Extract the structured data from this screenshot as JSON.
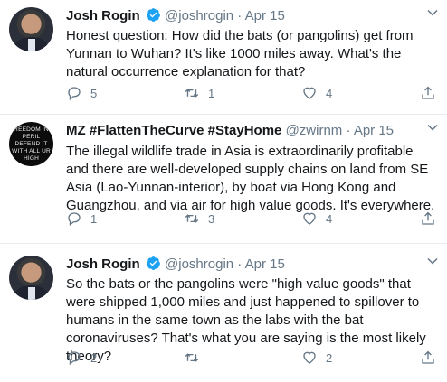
{
  "tweets": [
    {
      "name": "Josh Rogin",
      "handle": "@joshrogin",
      "dot": "·",
      "date": "Apr 15",
      "text": "Honest question: How did the bats (or pangolins) get from Yunnan to Wuhan? It's like 1000 miles away. What's the natural occurrence explanation for that?",
      "replies": "5",
      "retweets": "1",
      "likes": "4"
    },
    {
      "name": "MZ #FlattenTheCurve #StayHome",
      "handle": "@zwirnm",
      "dot": "·",
      "date": "Apr 15",
      "avatar_text": "REEDOM IN PERIL DEFEND IT WITH ALL UR HIGH",
      "text": "The illegal wildlife trade in Asia is extraordinarily profitable and there are well-developed supply chains on land from SE Asia (Lao-Yunnan-interior), by boat via Hong Kong and Guangzhou, and via air for high value goods. It's everywhere.",
      "replies": "1",
      "retweets": "3",
      "likes": "4"
    },
    {
      "name": "Josh Rogin",
      "handle": "@joshrogin",
      "dot": "·",
      "date": "Apr 15",
      "text": "So the bats or the pangolins were \"high value goods\" that were shipped 1,000 miles and just happened to spillover to humans in the same town as the labs with the bat coronaviruses? That's what you are saying is the most likely theory?",
      "replies": "2",
      "retweets": "",
      "likes": "2"
    }
  ],
  "icons": {
    "verified": "verified-badge-icon",
    "caret": "chevron-down-icon",
    "reply": "reply-icon",
    "retweet": "retweet-icon",
    "like": "heart-icon",
    "share": "share-icon"
  },
  "colors": {
    "text": "#14171a",
    "secondary": "#657786",
    "verified": "#1da1f2",
    "divider": "#e6ecf0"
  }
}
